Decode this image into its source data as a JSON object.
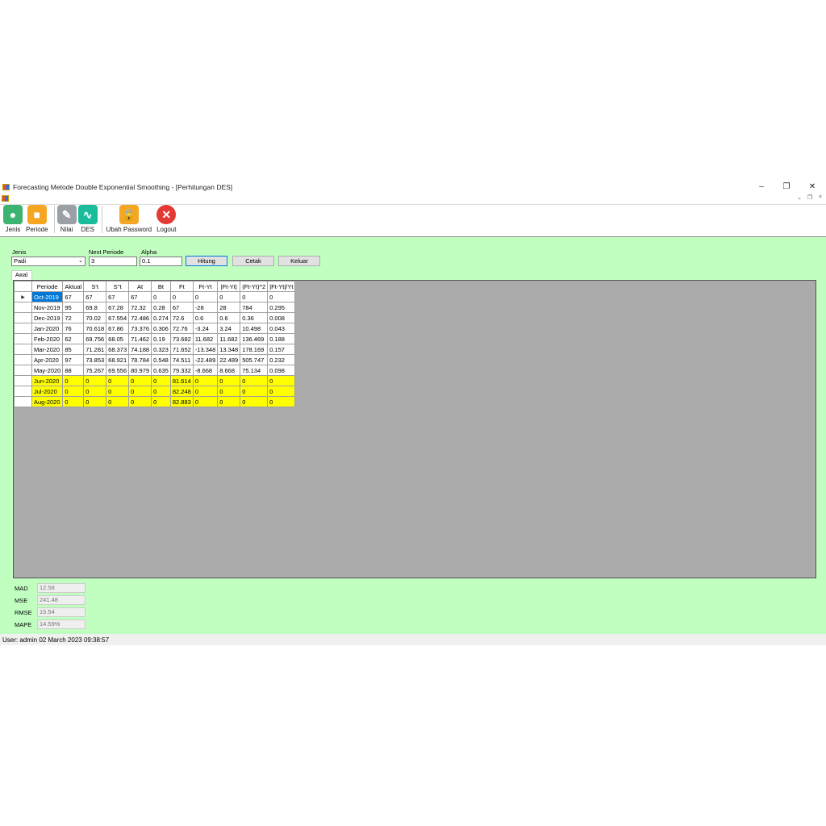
{
  "window": {
    "title": "Forecasting Metode Double Exponential Smoothing - [Perhitungan DES]"
  },
  "toolbar": [
    {
      "label": "Jenis",
      "icon": "tag-icon",
      "color": "#3cb371"
    },
    {
      "label": "Periode",
      "icon": "brick-icon",
      "color": "#f5a623"
    },
    {
      "label": "Nilai",
      "icon": "notepad-icon",
      "color": "#9aa0a6"
    },
    {
      "label": "DES",
      "icon": "pulse-icon",
      "color": "#1abc9c"
    },
    {
      "label": "Ubah Password",
      "icon": "lock-icon",
      "color": "#f5a623"
    },
    {
      "label": "Logout",
      "icon": "close-circle-icon",
      "color": "#e53935"
    }
  ],
  "form": {
    "jenis_label": "Jenis",
    "jenis_value": "Padi",
    "next_label": "Next Periode",
    "next_value": "3",
    "alpha_label": "Alpha",
    "alpha_value": "0.1",
    "hitung": "Hitung",
    "cetak": "Cetak",
    "keluar": "Keluar",
    "tab": "Awal"
  },
  "table": {
    "headers": [
      "Periode",
      "Aktual",
      "S't",
      "S''t",
      "At",
      "Bt",
      "Ft",
      "Ft-Yt",
      "|Ft-Yt|",
      "(Ft-Yt)^2",
      "|Ft-Yt|/Yt"
    ],
    "rows": [
      [
        "Oct-2019",
        "67",
        "67",
        "67",
        "67",
        "0",
        "0",
        "0",
        "0",
        "0",
        "0"
      ],
      [
        "Nov-2019",
        "95",
        "69.8",
        "67.28",
        "72.32",
        "0.28",
        "67",
        "-28",
        "28",
        "784",
        "0.295"
      ],
      [
        "Dec-2019",
        "72",
        "70.02",
        "67.554",
        "72.486",
        "0.274",
        "72.6",
        "0.6",
        "0.6",
        "0.36",
        "0.008"
      ],
      [
        "Jan-2020",
        "76",
        "70.618",
        "67.86",
        "73.376",
        "0.306",
        "72.76",
        "-3.24",
        "3.24",
        "10.498",
        "0.043"
      ],
      [
        "Feb-2020",
        "62",
        "69.756",
        "68.05",
        "71.462",
        "0.19",
        "73.682",
        "11.682",
        "11.682",
        "136.469",
        "0.188"
      ],
      [
        "Mar-2020",
        "85",
        "71.281",
        "68.373",
        "74.188",
        "0.323",
        "71.652",
        "-13.348",
        "13.348",
        "178.169",
        "0.157"
      ],
      [
        "Apr-2020",
        "97",
        "73.853",
        "68.921",
        "78.784",
        "0.548",
        "74.511",
        "-22.489",
        "22.489",
        "505.747",
        "0.232"
      ],
      [
        "May-2020",
        "88",
        "75.267",
        "69.556",
        "80.979",
        "0.635",
        "79.332",
        "-8.668",
        "8.668",
        "75.134",
        "0.098"
      ],
      [
        "Jun-2020",
        "0",
        "0",
        "0",
        "0",
        "0",
        "81.614",
        "0",
        "0",
        "0",
        "0"
      ],
      [
        "Jul-2020",
        "0",
        "0",
        "0",
        "0",
        "0",
        "82.248",
        "0",
        "0",
        "0",
        "0"
      ],
      [
        "Aug-2020",
        "0",
        "0",
        "0",
        "0",
        "0",
        "82.883",
        "0",
        "0",
        "0",
        "0"
      ]
    ],
    "forecast_rows_start": 8
  },
  "stats": [
    {
      "label": "MAD",
      "value": "12.58"
    },
    {
      "label": "MSE",
      "value": "241.48"
    },
    {
      "label": "RMSE",
      "value": "15.54"
    },
    {
      "label": "MAPE",
      "value": "14.59%"
    }
  ],
  "status": {
    "text": "User: admin  02 March 2023 09:38:57"
  }
}
